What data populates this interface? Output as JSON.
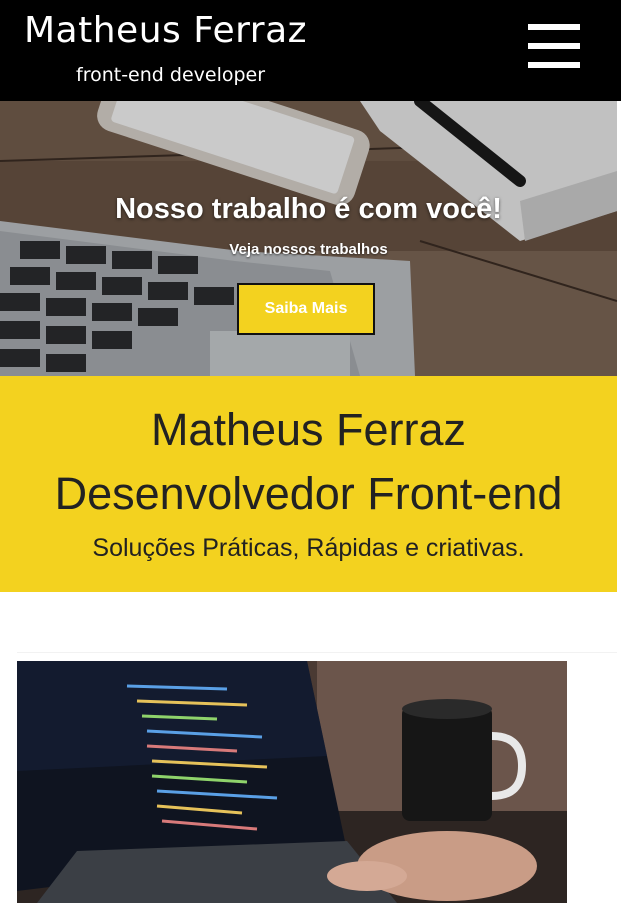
{
  "header": {
    "title": "Matheus Ferraz",
    "subtitle": "front-end developer",
    "menu_icon": "hamburger-menu-icon"
  },
  "hero": {
    "heading": "Nosso trabalho é com você!",
    "subheading": "Veja nossos trabalhos",
    "cta_label": "Saiba Mais"
  },
  "about": {
    "name": "Matheus Ferraz",
    "role": "Desenvolvedor Front-end",
    "tagline": "Soluções Práticas, Rápidas e criativas."
  },
  "colors": {
    "header_bg": "#000000",
    "accent_yellow": "#f3d21f",
    "text_dark": "#222222"
  }
}
